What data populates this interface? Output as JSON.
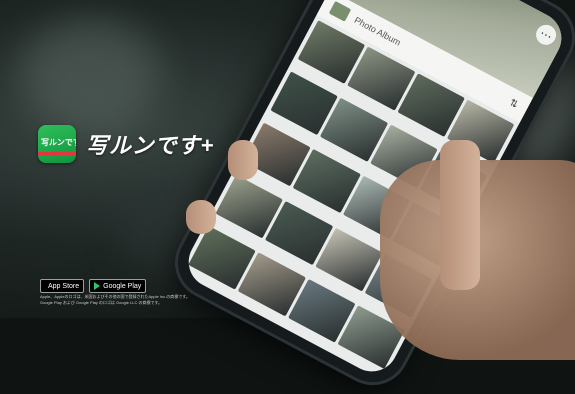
{
  "brand": {
    "app_icon_name": "shashin-runpu-app-icon",
    "app_icon_text": "写ルンです+",
    "wordmark": "写ルンです+"
  },
  "phone_screen": {
    "album_title": "Photo Album",
    "sort_icon": "sort-icon",
    "hero_buttons": [
      "back-icon",
      "more-icon"
    ],
    "thumbnail_colors": [
      "#6f7a66",
      "#8b9383",
      "#5e6b5c",
      "#b7b6a6",
      "#3f5148",
      "#7d8f85",
      "#a7aea0",
      "#54636a",
      "#8a7a6b",
      "#5c6e60",
      "#aab7b3",
      "#6b7c8a",
      "#9aa18c",
      "#4a5a52",
      "#c4c1b3",
      "#76858a",
      "#5f6f5a",
      "#a39a8a",
      "#68787e",
      "#8e9c8f"
    ]
  },
  "store_badges": {
    "app_store": "App Store",
    "google_play": "Google Play"
  },
  "legal_text": [
    "Apple、Appleのロゴは、米国およびその他の国で登録されたApple Inc.の商標です。",
    "Google Play および Google Play のロゴは Google LLC の商標です。"
  ],
  "colors": {
    "brand_green": "#1fa94c",
    "brand_red": "#e0383e"
  }
}
